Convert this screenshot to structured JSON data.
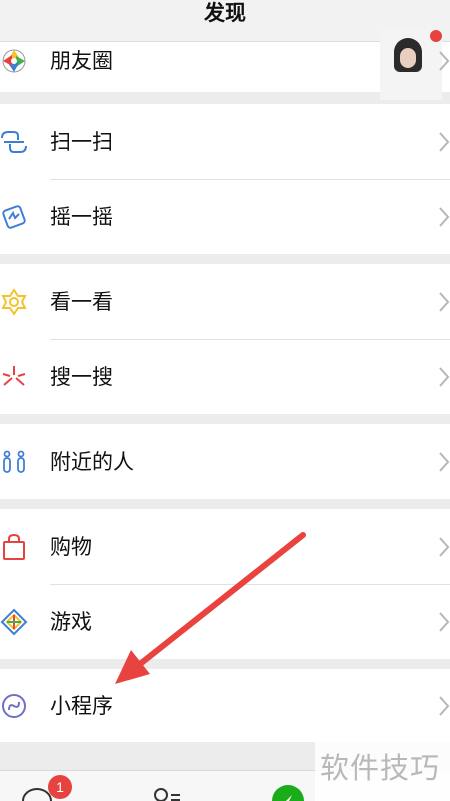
{
  "header": {
    "title": "发现"
  },
  "groups": {
    "moments": {
      "label": "朋友圈"
    },
    "scan": {
      "label": "扫一扫"
    },
    "shake": {
      "label": "摇一摇"
    },
    "look": {
      "label": "看一看"
    },
    "search": {
      "label": "搜一搜"
    },
    "nearby": {
      "label": "附近的人"
    },
    "shopping": {
      "label": "购物"
    },
    "games": {
      "label": "游戏"
    },
    "miniprograms": {
      "label": "小程序"
    }
  },
  "tabbar": {
    "chats_badge": "1"
  },
  "watermark": {
    "text": "软件技巧"
  },
  "icons": {
    "moments": "aperture-icon",
    "scan": "scan-icon",
    "shake": "shake-icon",
    "look": "look-icon",
    "search": "search-star-icon",
    "nearby": "people-icon",
    "shopping": "shopping-bag-icon",
    "games": "game-diamond-icon",
    "miniprograms": "mini-program-icon",
    "chevron": "chevron-right-icon"
  },
  "colors": {
    "accent_red": "#e64340",
    "wechat_green": "#1aad19",
    "scan_blue": "#3d7fd6",
    "look_yellow": "#f4c22b",
    "mini_purple": "#6f6fc8"
  }
}
